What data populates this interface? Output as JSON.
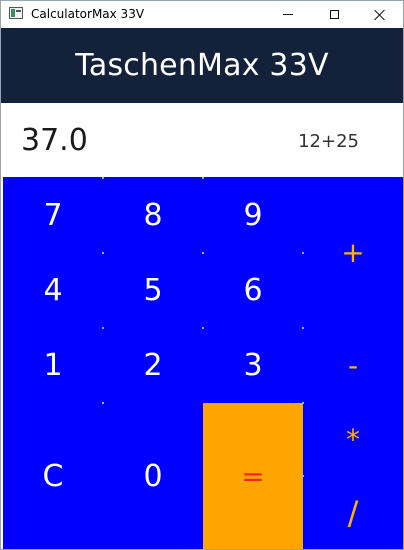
{
  "window": {
    "title": "CalculatorMax 33V"
  },
  "header": {
    "title": "TaschenMax 33V"
  },
  "display": {
    "result": "37.0",
    "expression": "12+25"
  },
  "keys": {
    "k7": "7",
    "k8": "8",
    "k9": "9",
    "k4": "4",
    "k5": "5",
    "k6": "6",
    "k1": "1",
    "k2": "2",
    "k3": "3",
    "clear": "C",
    "k0": "0",
    "equals": "=",
    "plus": "+",
    "minus": "-",
    "multiply": "*",
    "divide": "/"
  },
  "colors": {
    "header_bg": "#13213b",
    "keypad_bg": "#0000ff",
    "equals_bg": "#ffa500",
    "equals_text": "#ff2020",
    "operator_text": "#ffb300"
  }
}
